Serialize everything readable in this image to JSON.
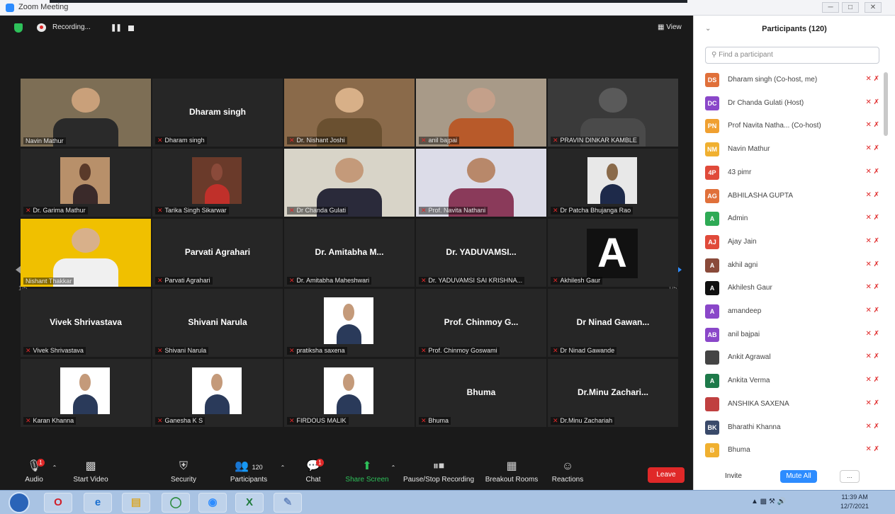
{
  "window": {
    "title": "Zoom Meeting"
  },
  "topbar": {
    "recording_label": "Recording...",
    "view_label": "View"
  },
  "pages": {
    "left": "1/5",
    "right": "1/5"
  },
  "tiles": [
    {
      "name": "Navin Mathur",
      "big": "",
      "kind": "photo",
      "muted": false
    },
    {
      "name": "Dharam singh",
      "big": "Dharam singh",
      "kind": "name",
      "muted": true
    },
    {
      "name": "Dr. Nishant Joshi",
      "big": "",
      "kind": "photo",
      "muted": true
    },
    {
      "name": "anil bajpai",
      "big": "",
      "kind": "photo",
      "muted": true
    },
    {
      "name": "PRAVIN DINKAR KAMBLE",
      "big": "",
      "kind": "photo",
      "muted": true
    },
    {
      "name": "Dr. Garima Mathur",
      "big": "",
      "kind": "photo",
      "muted": true
    },
    {
      "name": "Tarika Singh Sikarwar",
      "big": "",
      "kind": "photo",
      "muted": true
    },
    {
      "name": "Dr Chanda Gulati",
      "big": "",
      "kind": "photo",
      "muted": true
    },
    {
      "name": "Prof. Navita Nathani",
      "big": "",
      "kind": "photo",
      "muted": true
    },
    {
      "name": "Dr Patcha Bhujanga Rao",
      "big": "",
      "kind": "photo",
      "muted": true
    },
    {
      "name": "Nishant Thakkar",
      "big": "",
      "kind": "photo",
      "muted": false
    },
    {
      "name": "Parvati Agrahari",
      "big": "Parvati Agrahari",
      "kind": "name",
      "muted": true
    },
    {
      "name": "Dr. Amitabha Maheshwari",
      "big": "Dr. Amitabha M...",
      "kind": "name",
      "muted": true
    },
    {
      "name": "Dr. YADUVAMSI SAI KRISHNA...",
      "big": "Dr. YADUVAMSI...",
      "kind": "name",
      "muted": true
    },
    {
      "name": "Akhilesh Gaur",
      "big": "",
      "kind": "letter",
      "muted": true
    },
    {
      "name": "Vivek Shrivastava",
      "big": "Vivek Shrivastava",
      "kind": "name",
      "muted": true
    },
    {
      "name": "Shivani Narula",
      "big": "Shivani Narula",
      "kind": "name",
      "muted": true
    },
    {
      "name": "pratiksha saxena",
      "big": "",
      "kind": "photo",
      "muted": true
    },
    {
      "name": "Prof. Chinmoy Goswami",
      "big": "Prof. Chinmoy G...",
      "kind": "name",
      "muted": true
    },
    {
      "name": "Dr Ninad Gawande",
      "big": "Dr Ninad Gawan...",
      "kind": "name",
      "muted": true
    },
    {
      "name": "Karan Khanna",
      "big": "",
      "kind": "photo",
      "muted": true
    },
    {
      "name": "Ganesha K S",
      "big": "",
      "kind": "photo",
      "muted": true
    },
    {
      "name": "FIRDOUS MALIK",
      "big": "",
      "kind": "photo",
      "muted": true
    },
    {
      "name": "Bhuma",
      "big": "Bhuma",
      "kind": "name",
      "muted": true
    },
    {
      "name": "Dr.Minu Zachariah",
      "big": "Dr.Minu Zachari...",
      "kind": "name",
      "muted": true
    }
  ],
  "toolbar": {
    "audio": "Audio",
    "start_video": "Start Video",
    "security": "Security",
    "participants": "Participants",
    "participants_count": "120",
    "chat": "Chat",
    "share_screen": "Share Screen",
    "pause_stop_recording": "Pause/Stop Recording",
    "breakout_rooms": "Breakout Rooms",
    "reactions": "Reactions",
    "leave": "Leave",
    "audio_badge": "1",
    "chat_badge": "1"
  },
  "panel": {
    "title": "Participants (120)",
    "search_placeholder": "Find a participant",
    "invite": "Invite",
    "mute_all": "Mute All",
    "more": "...",
    "participants": [
      {
        "initials": "DS",
        "name": "Dharam singh (Co-host, me)",
        "color": "#e0703a"
      },
      {
        "initials": "DC",
        "name": "Dr Chanda Gulati (Host)",
        "color": "#8a47c9"
      },
      {
        "initials": "PN",
        "name": "Prof Navita Natha... (Co-host)",
        "color": "#f0a030"
      },
      {
        "initials": "NM",
        "name": "Navin Mathur",
        "color": "#f0b030"
      },
      {
        "initials": "4P",
        "name": "43 pimr",
        "color": "#e04a3a"
      },
      {
        "initials": "AG",
        "name": "ABHILASHA GUPTA",
        "color": "#e0703a"
      },
      {
        "initials": "A",
        "name": "Admin",
        "color": "#2eaa55"
      },
      {
        "initials": "AJ",
        "name": "Ajay Jain",
        "color": "#e04a3a"
      },
      {
        "initials": "A",
        "name": "akhil agni",
        "color": "#8a4a3a"
      },
      {
        "initials": "A",
        "name": "Akhilesh Gaur",
        "color": "#111111"
      },
      {
        "initials": "A",
        "name": "amandeep",
        "color": "#8a47c9"
      },
      {
        "initials": "AB",
        "name": "anil bajpai",
        "color": "#8a47c9"
      },
      {
        "initials": "",
        "name": "Ankit Agrawal",
        "color": "#444444"
      },
      {
        "initials": "A",
        "name": "Ankita Verma",
        "color": "#1e7a4a"
      },
      {
        "initials": "",
        "name": "ANSHIKA SAXENA",
        "color": "#c04040"
      },
      {
        "initials": "BK",
        "name": "Bharathi Khanna",
        "color": "#3a4a6a"
      },
      {
        "initials": "B",
        "name": "Bhuma",
        "color": "#f0b030"
      }
    ]
  },
  "taskbar": {
    "time": "11:39 AM",
    "date": "12/7/2021"
  }
}
